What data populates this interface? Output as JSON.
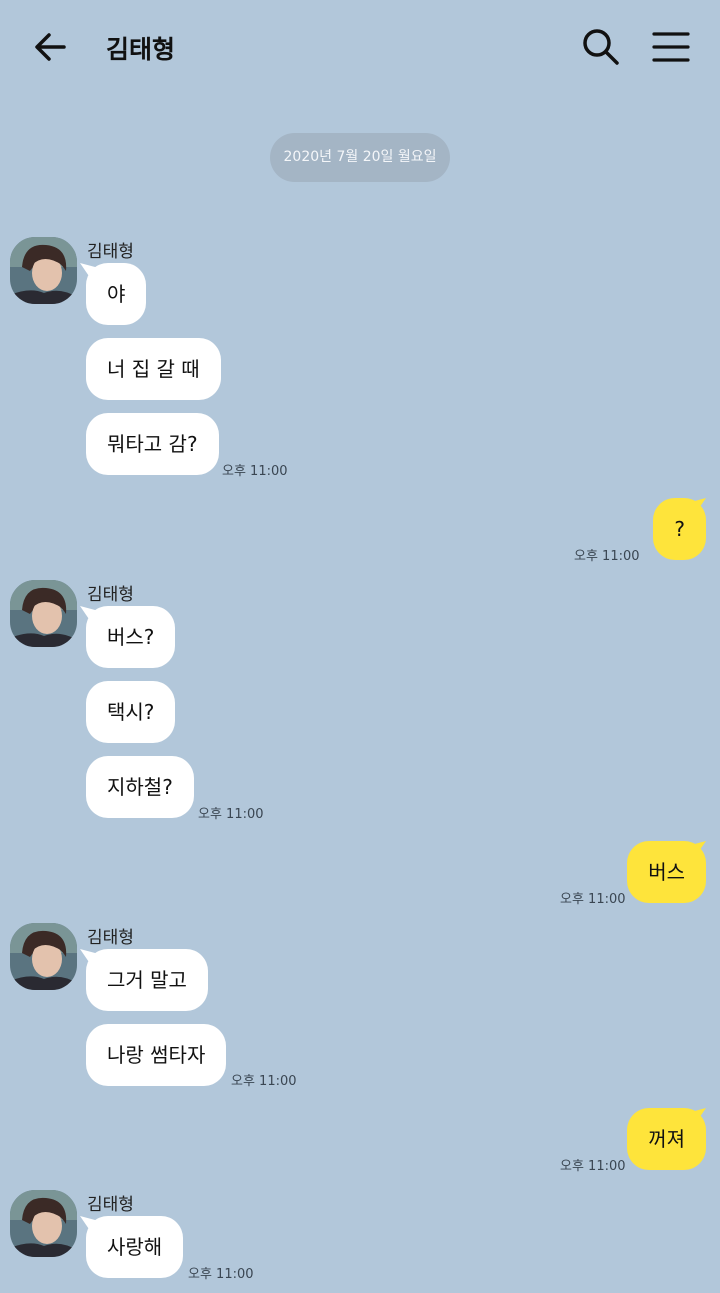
{
  "header": {
    "title": "김태형",
    "back_icon": "arrow-left-icon",
    "search_icon": "search-icon",
    "menu_icon": "hamburger-menu-icon"
  },
  "date_divider": "2020년 7월 20일 월요일",
  "colors": {
    "background": "#b2c7da",
    "incoming": "#ffffff",
    "outgoing": "#fee43b"
  },
  "messages": {
    "g1": {
      "sender": "김태형",
      "lines": [
        "야",
        "너 집 갈 때",
        "뭐타고 감?"
      ],
      "time": "오후 11:00"
    },
    "r1": {
      "text": "?",
      "time": "오후 11:00"
    },
    "g2": {
      "sender": "김태형",
      "lines": [
        "버스?",
        "택시?",
        "지하철?"
      ],
      "time": "오후 11:00"
    },
    "r2": {
      "text": "버스",
      "time": "오후 11:00"
    },
    "g3": {
      "sender": "김태형",
      "lines": [
        "그거 말고",
        "나랑 썸타자"
      ],
      "time": "오후 11:00"
    },
    "r3": {
      "text": "꺼져",
      "time": "오후 11:00"
    },
    "g4": {
      "sender": "김태형",
      "lines": [
        "사랑해"
      ],
      "time": "오후 11:00"
    }
  }
}
